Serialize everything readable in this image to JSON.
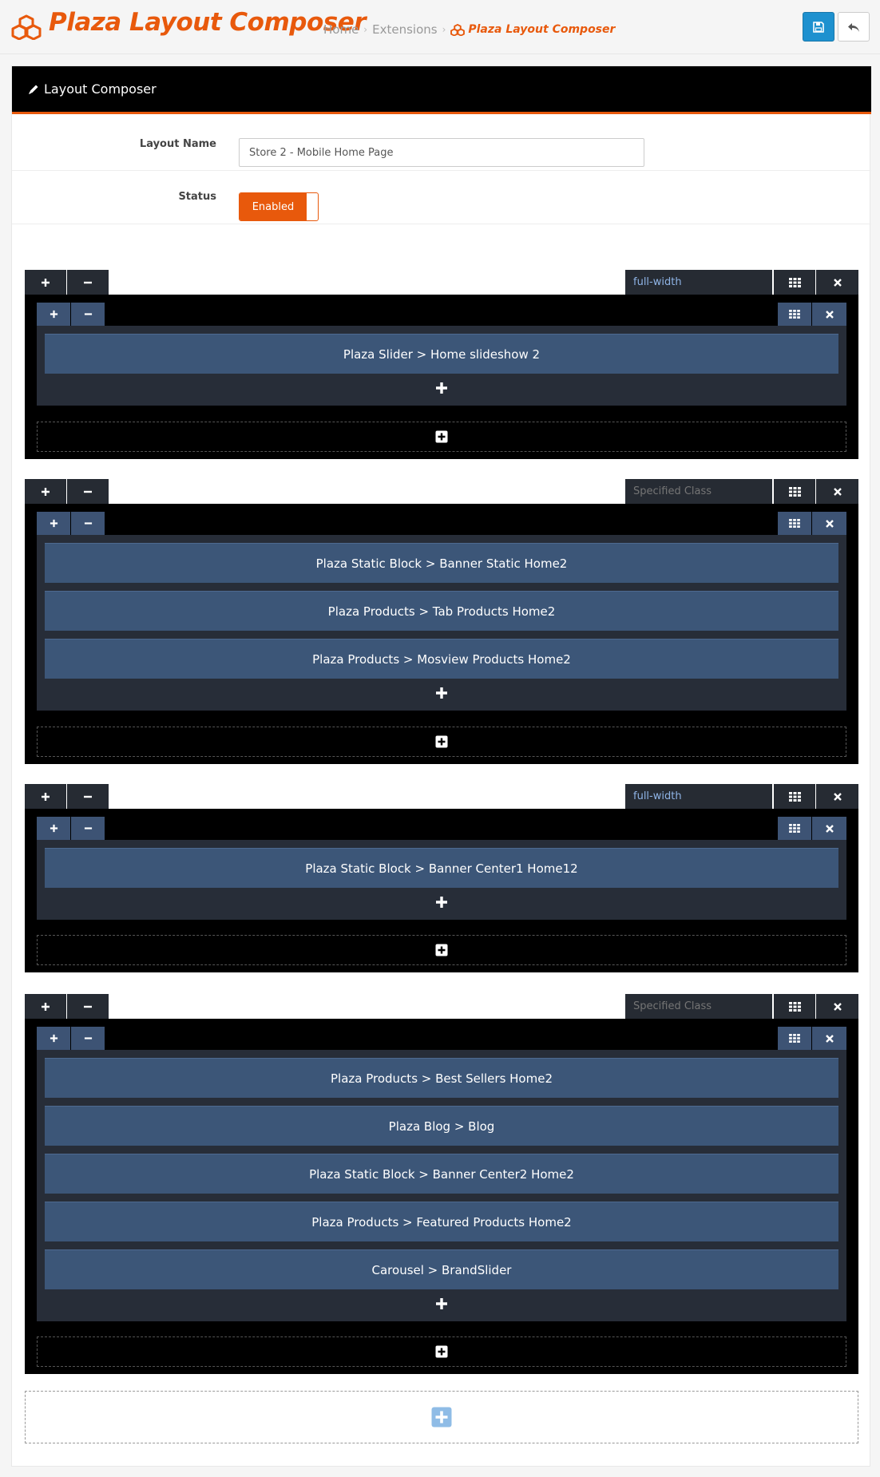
{
  "header": {
    "title": "Plaza Layout Composer",
    "breadcrumb": [
      "Home",
      "Extensions",
      "Plaza Layout Composer"
    ]
  },
  "panel": {
    "heading": "Layout Composer"
  },
  "form": {
    "layout_name_label": "Layout Name",
    "layout_name_value": "Store 2 - Mobile Home Page",
    "status_label": "Status",
    "status_value": "Enabled"
  },
  "rows": [
    {
      "class_value": "full-width",
      "class_placeholder": "",
      "modules": [
        "Plaza Slider > Home slideshow 2"
      ]
    },
    {
      "class_value": "",
      "class_placeholder": "Specified Class",
      "modules": [
        "Plaza Static Block > Banner Static Home2",
        "Plaza Products > Tab Products Home2",
        "Plaza Products > Mosview Products Home2"
      ]
    },
    {
      "class_value": "full-width",
      "class_placeholder": "",
      "modules": [
        "Plaza Static Block > Banner Center1 Home12"
      ]
    },
    {
      "class_value": "",
      "class_placeholder": "Specified Class",
      "modules": [
        "Plaza Products > Best Sellers Home2",
        "Plaza Blog > Blog",
        "Plaza Static Block > Banner Center2 Home2",
        "Plaza Products > Featured Products Home2",
        "Carousel > BrandSlider"
      ]
    }
  ],
  "colors": {
    "accent": "#e8590c",
    "save": "#1e91cf",
    "module": "#3c5678",
    "toolbar": "#262b33"
  }
}
